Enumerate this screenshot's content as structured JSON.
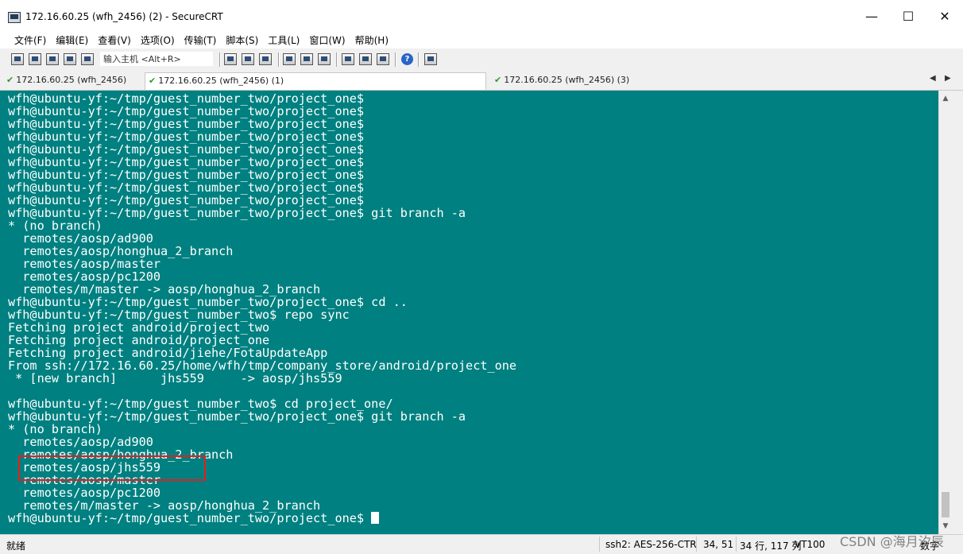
{
  "window": {
    "title": "172.16.60.25 (wfh_2456) (2) - SecureCRT",
    "controls": {
      "minimize": "—",
      "maximize": "☐",
      "close": "✕"
    }
  },
  "menu": {
    "items": [
      "文件(F)",
      "编辑(E)",
      "查看(V)",
      "选项(O)",
      "传输(T)",
      "脚本(S)",
      "工具(L)",
      "窗口(W)",
      "帮助(H)"
    ]
  },
  "toolbar": {
    "quick_connect_label": "输入主机 <Alt+R>",
    "help_glyph": "?"
  },
  "tabs": [
    {
      "label": "172.16.60.25 (wfh_2456)",
      "active": false
    },
    {
      "label": "172.16.60.25 (wfh_2456) (1)",
      "active": true
    },
    {
      "label": "172.16.60.25 (wfh_2456) (3)",
      "active": false
    }
  ],
  "tab_nav": {
    "prev": "◀",
    "next": "▶"
  },
  "terminal": {
    "background": "#008080",
    "lines": [
      "wfh@ubuntu-yf:~/tmp/guest_number_two/project_one$",
      "wfh@ubuntu-yf:~/tmp/guest_number_two/project_one$",
      "wfh@ubuntu-yf:~/tmp/guest_number_two/project_one$",
      "wfh@ubuntu-yf:~/tmp/guest_number_two/project_one$",
      "wfh@ubuntu-yf:~/tmp/guest_number_two/project_one$",
      "wfh@ubuntu-yf:~/tmp/guest_number_two/project_one$",
      "wfh@ubuntu-yf:~/tmp/guest_number_two/project_one$",
      "wfh@ubuntu-yf:~/tmp/guest_number_two/project_one$",
      "wfh@ubuntu-yf:~/tmp/guest_number_two/project_one$",
      "wfh@ubuntu-yf:~/tmp/guest_number_two/project_one$ git branch -a",
      "* (no branch)",
      "  remotes/aosp/ad900",
      "  remotes/aosp/honghua_2_branch",
      "  remotes/aosp/master",
      "  remotes/aosp/pc1200",
      "  remotes/m/master -> aosp/honghua_2_branch",
      "wfh@ubuntu-yf:~/tmp/guest_number_two/project_one$ cd ..",
      "wfh@ubuntu-yf:~/tmp/guest_number_two$ repo sync",
      "Fetching project android/project_two",
      "Fetching project android/project_one",
      "Fetching project android/jiehe/FotaUpdateApp",
      "From ssh://172.16.60.25/home/wfh/tmp/company_store/android/project_one",
      " * [new branch]      jhs559     -> aosp/jhs559",
      "",
      "wfh@ubuntu-yf:~/tmp/guest_number_two$ cd project_one/",
      "wfh@ubuntu-yf:~/tmp/guest_number_two/project_one$ git branch -a",
      "* (no branch)",
      "  remotes/aosp/ad900",
      "  remotes/aosp/honghua_2_branch",
      "  remotes/aosp/jhs559",
      "  remotes/aosp/master",
      "  remotes/aosp/pc1200",
      "  remotes/m/master -> aosp/honghua_2_branch"
    ],
    "prompt": "wfh@ubuntu-yf:~/tmp/guest_number_two/project_one$ "
  },
  "statusbar": {
    "ready": "就绪",
    "encryption": "ssh2: AES-256-CTR",
    "cursor_pos": "34, 51",
    "dimensions": "34 行, 117 列",
    "terminal_type": "VT100",
    "num_lock": "数字"
  },
  "watermark": "CSDN @海月汐辰",
  "colors": {
    "terminal_bg": "#008080",
    "highlight_border": "#e02020"
  }
}
